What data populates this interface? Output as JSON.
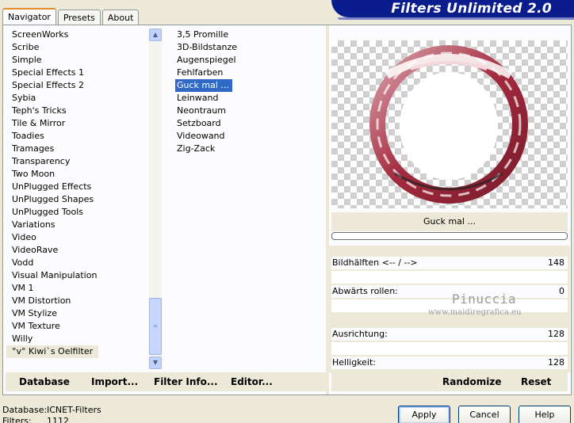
{
  "header": {
    "title": "Filters Unlimited 2.0"
  },
  "tabs": [
    "Navigator",
    "Presets",
    "About"
  ],
  "categories": [
    "ScreenWorks",
    "Scribe",
    "Simple",
    "Special Effects 1",
    "Special Effects 2",
    "Sybia",
    "Teph's Tricks",
    "Tile & Mirror",
    "Toadies",
    "Tramages",
    "Transparency",
    "Two Moon",
    "UnPlugged Effects",
    "UnPlugged Shapes",
    "UnPlugged Tools",
    "Variations",
    "Video",
    "VideoRave",
    "Vodd",
    "Visual Manipulation",
    "VM 1",
    "VM Distortion",
    "VM Stylize",
    "VM Texture",
    "Willy",
    "°v° Kiwi`s Oelfilter"
  ],
  "selected_category": "°v° Kiwi`s Oelfilter",
  "filters": [
    "3,5 Promille",
    "3D-Bildstanze",
    "Augenspiegel",
    "Fehlfarben",
    "Guck mal ...",
    "Leinwand",
    "Neontraum",
    "Setzboard",
    "Videowand",
    "Zig-Zack"
  ],
  "selected_filter": "Guck mal ...",
  "preview": {
    "filter_name": "Guck mal ...",
    "ring_color": "#b0394c"
  },
  "params": [
    {
      "label": "Bildhälften <-- / -->",
      "value": "148"
    },
    {
      "label": "Abwärts rollen:",
      "value": "0"
    },
    {
      "label": "Ausrichtung:",
      "value": "128"
    },
    {
      "label": "Helligkeit:",
      "value": "128"
    }
  ],
  "watermark": {
    "name": "Pinuccia",
    "site": "www.maidiregrafica.eu"
  },
  "links": {
    "database": "Database",
    "import": "Import...",
    "filter_info": "Filter Info...",
    "editor": "Editor...",
    "randomize": "Randomize",
    "reset": "Reset"
  },
  "status": {
    "database_label": "Database:",
    "database_value": "ICNET-Filters",
    "filters_label": "Filters:",
    "filters_value": "1112"
  },
  "buttons": {
    "apply": "Apply",
    "cancel": "Cancel",
    "help": "Help"
  }
}
